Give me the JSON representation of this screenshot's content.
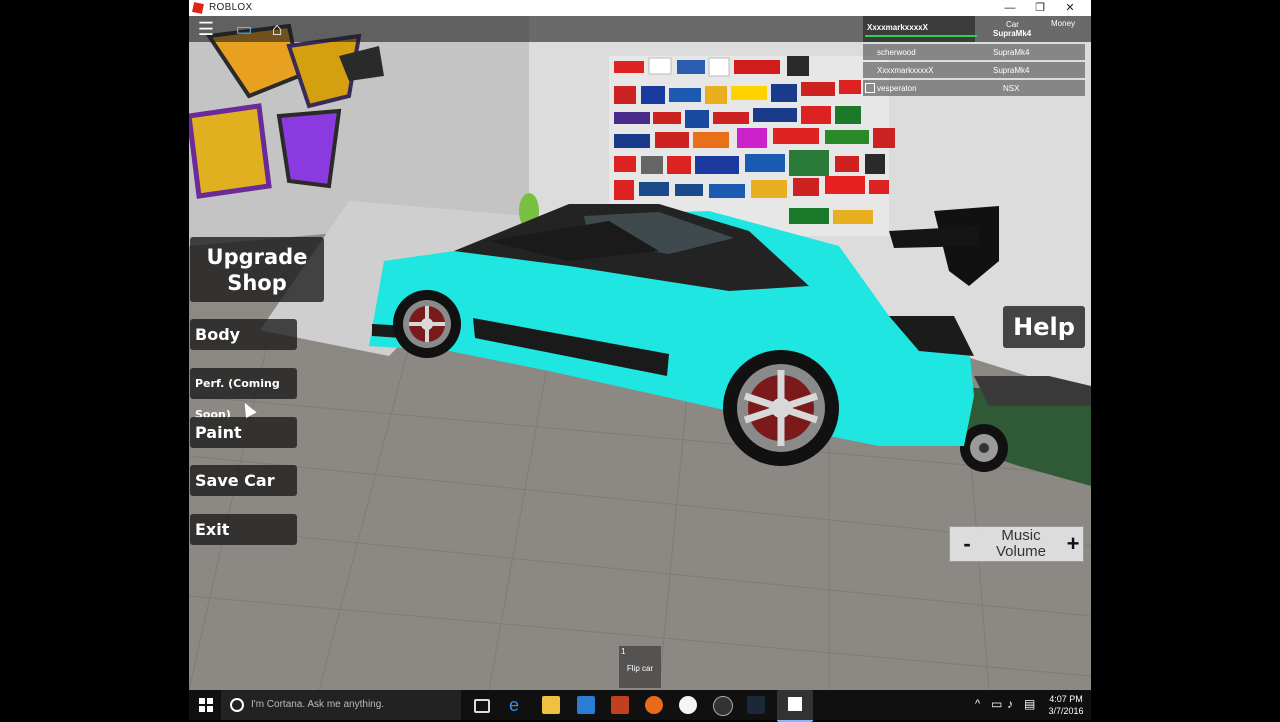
{
  "window": {
    "title": "ROBLOX",
    "minimize": "—",
    "restore": "❐",
    "close": "✕"
  },
  "topbar": {
    "menu_icon": "hamburger-menu-icon",
    "chat_icon": "chat-icon",
    "backpack_icon": "backpack-icon"
  },
  "upgrade_shop": {
    "title": "Upgrade Shop"
  },
  "side_menu": [
    {
      "label": "Body"
    },
    {
      "label": "Perf. (Coming Soon)"
    },
    {
      "label": "Paint"
    },
    {
      "label": "Save Car"
    },
    {
      "label": "Exit"
    }
  ],
  "help_label": "Help",
  "playerlist": {
    "local_player": "XxxxmarkxxxxX",
    "car_header": "Car",
    "local_car": "SupraMk4",
    "money_header": "Money",
    "players": [
      {
        "name": "scherwood",
        "car": "SupraMk4"
      },
      {
        "name": "XxxxmarkxxxxX",
        "car": "SupraMk4"
      },
      {
        "name": "vesperaton",
        "car": "NSX"
      }
    ]
  },
  "music": {
    "minus": "-",
    "label": "Music Volume",
    "plus": "+"
  },
  "hotbar": {
    "slot_number": "1",
    "slot_label": "Flip car"
  },
  "taskbar": {
    "search_placeholder": "I'm Cortana. Ask me anything.",
    "time": "4:07 PM",
    "date": "3/7/2016"
  },
  "colors": {
    "car_body": "#1fe6e0",
    "roblox_red": "#e2231a",
    "panel_dark": "#191919"
  }
}
